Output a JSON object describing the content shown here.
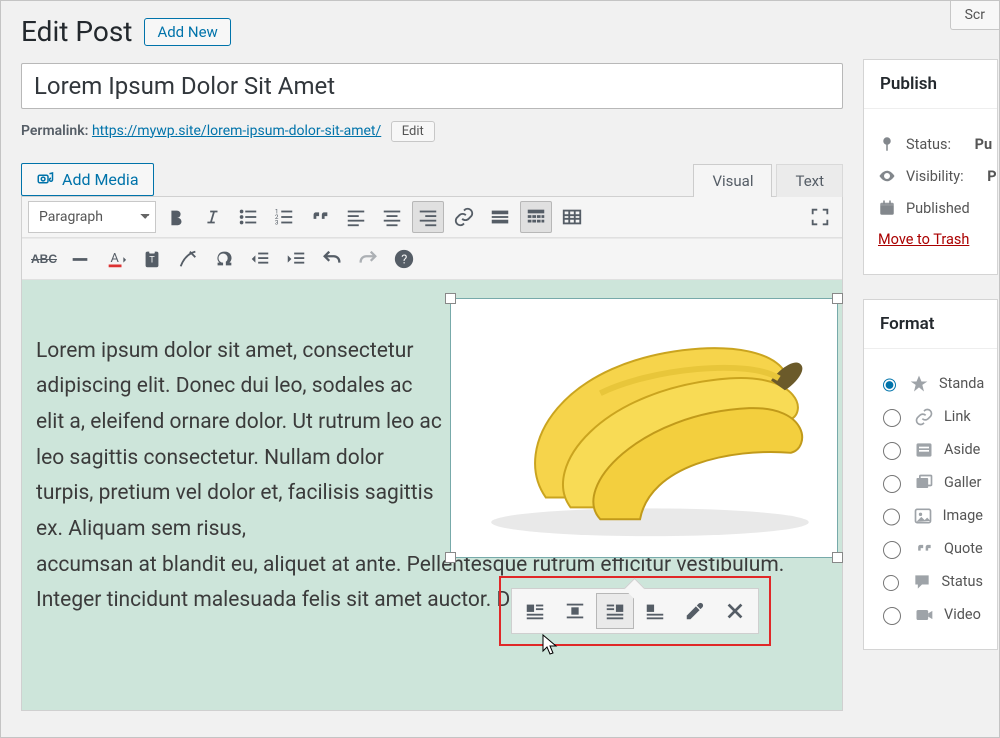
{
  "page": {
    "heading": "Edit Post"
  },
  "buttons": {
    "add_new": "Add New",
    "add_media": "Add Media",
    "edit_slug": "Edit",
    "screen": "Scr"
  },
  "post": {
    "title": "Lorem Ipsum Dolor Sit Amet",
    "permalink_label": "Permalink:",
    "permalink_base": "https://mywp.site/",
    "permalink_slug": "lorem-ipsum-dolor-sit-amet/"
  },
  "tabs": {
    "visual": "Visual",
    "text": "Text",
    "active": "visual"
  },
  "formats": {
    "paragraph": "Paragraph"
  },
  "content": {
    "para1": "Lorem ipsum dolor sit amet, consectetur adipiscing elit. Donec dui leo, sodales ac elit a, eleifend ornare dolor. Ut rutrum leo ac leo sagittis consectetur. Nullam dolor turpis, pretium vel dolor et, facilisis sagittis ex. Aliquam sem risus,",
    "para2": "accumsan at blandit eu, aliquet at ante. Pellentesque rutrum efficitur vestibulum. Integer tincidunt malesuada felis sit amet auctor. Donec"
  },
  "image": {
    "alt": "bananas"
  },
  "image_toolbar": {
    "items": [
      "align-left",
      "align-center",
      "align-right",
      "align-none",
      "edit",
      "remove"
    ],
    "active": "align-right"
  },
  "publish": {
    "heading": "Publish",
    "status_label": "Status:",
    "status_value": "Pu",
    "visibility_label": "Visibility:",
    "visibility_value": "P",
    "published_label": "Published",
    "trash": "Move to Trash"
  },
  "format_panel": {
    "heading": "Format",
    "options": [
      {
        "key": "standard",
        "label": "Standa",
        "checked": true
      },
      {
        "key": "link",
        "label": "Link",
        "checked": false
      },
      {
        "key": "aside",
        "label": "Aside",
        "checked": false
      },
      {
        "key": "gallery",
        "label": "Galler",
        "checked": false
      },
      {
        "key": "image",
        "label": "Image",
        "checked": false
      },
      {
        "key": "quote",
        "label": "Quote",
        "checked": false
      },
      {
        "key": "status",
        "label": "Status",
        "checked": false
      },
      {
        "key": "video",
        "label": "Video",
        "checked": false
      }
    ]
  }
}
